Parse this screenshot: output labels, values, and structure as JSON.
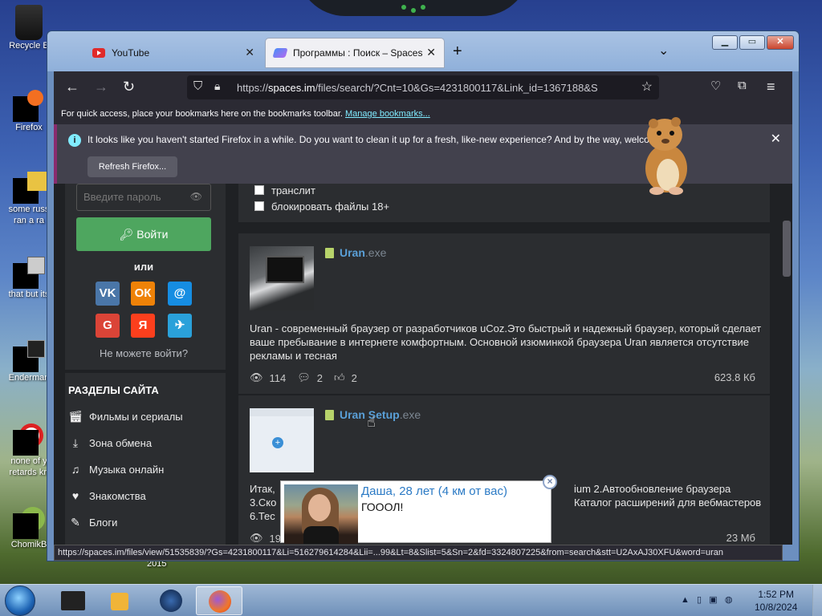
{
  "desktop": {
    "icons": [
      {
        "label": "Recycle B"
      },
      {
        "label": "Firefox"
      },
      {
        "label": "some russ"
      },
      {
        "label": "ran a ra"
      },
      {
        "label": "that but its"
      },
      {
        "label": "Enderman"
      },
      {
        "label": "none of y"
      },
      {
        "label": "retards kn"
      },
      {
        "label": "ChomikB"
      }
    ],
    "year_label": "2015"
  },
  "browser": {
    "tabs": [
      {
        "label": "YouTube",
        "icon": "youtube-icon"
      },
      {
        "label": "Программы : Поиск – Spaces",
        "icon": "spaces-icon"
      }
    ],
    "url_prefix": "https://",
    "url_host": "spaces.im",
    "url_rest": "/files/search/?Cnt=10&Gs=4231800117&Link_id=1367188&S",
    "bookmarks_text": "For quick access, place your bookmarks here on the bookmarks toolbar.",
    "bookmarks_link": "Manage bookmarks...",
    "notification": "It looks like you haven't started Firefox in a while. Do you want to clean it up for a fresh, like-new experience? And by the way, welcome back!",
    "refresh_button": "Refresh Firefox...",
    "status_url": "https://spaces.im/files/view/51535839/?Gs=4231800117&Li=516279614284&Lii=...99&Lt=8&Slist=5&Sn=2&fd=3324807225&from=search&stt=U2AxAJ30XFU&word=uran"
  },
  "sidebar": {
    "password_placeholder": "Введите пароль",
    "login_button": "Войти",
    "or_label": "или",
    "social": [
      {
        "label": "VK",
        "color": "#4a76a8"
      },
      {
        "label": "ОК",
        "color": "#ee8208"
      },
      {
        "label": "@",
        "color": "#168de2"
      },
      {
        "label": "G",
        "color": "#db4437"
      },
      {
        "label": "Я",
        "color": "#fc3f1d"
      },
      {
        "label": "✈",
        "color": "#2aa1da"
      }
    ],
    "cant_login": "Не можете войти?",
    "section_title": "РАЗДЕЛЫ САЙТА",
    "items": [
      {
        "label": "Фильмы и сериалы",
        "icon": "clapperboard-icon"
      },
      {
        "label": "Зона обмена",
        "icon": "download-icon"
      },
      {
        "label": "Музыка онлайн",
        "icon": "music-note-icon"
      },
      {
        "label": "Знакомства",
        "icon": "heart-icon"
      },
      {
        "label": "Блоги",
        "icon": "pen-icon"
      }
    ]
  },
  "filters": {
    "transliterate": "транслит",
    "block_18": "блокировать файлы 18+"
  },
  "results": [
    {
      "name": "Uran",
      "ext": ".exe",
      "description": "Uran - современный браузер от разработчиков uCoz.Это быстрый и надежный браузер, который сделает ваше пребывание в интернете комфортным. Основной изюминкой браузера Uran является отсутствие рекламы и тесная",
      "views": "114",
      "comments": "2",
      "likes": "2",
      "size": "623.8 Кб"
    },
    {
      "name": "Uran Setup",
      "ext": ".exe",
      "description_left": "Итак,",
      "description_right1": "ium 2.Автообновление браузера",
      "description_left2": "3.Ско",
      "description_right2": "Каталог расширений для вебмастеров",
      "description_left3": "6.Тес",
      "views": "19",
      "size": "23 Мб"
    }
  ],
  "ad": {
    "title": "Даша, 28 лет (4 км от вас)",
    "text": "ГОООЛ!"
  },
  "taskbar": {
    "time": "1:52 PM",
    "date": "10/8/2024"
  }
}
